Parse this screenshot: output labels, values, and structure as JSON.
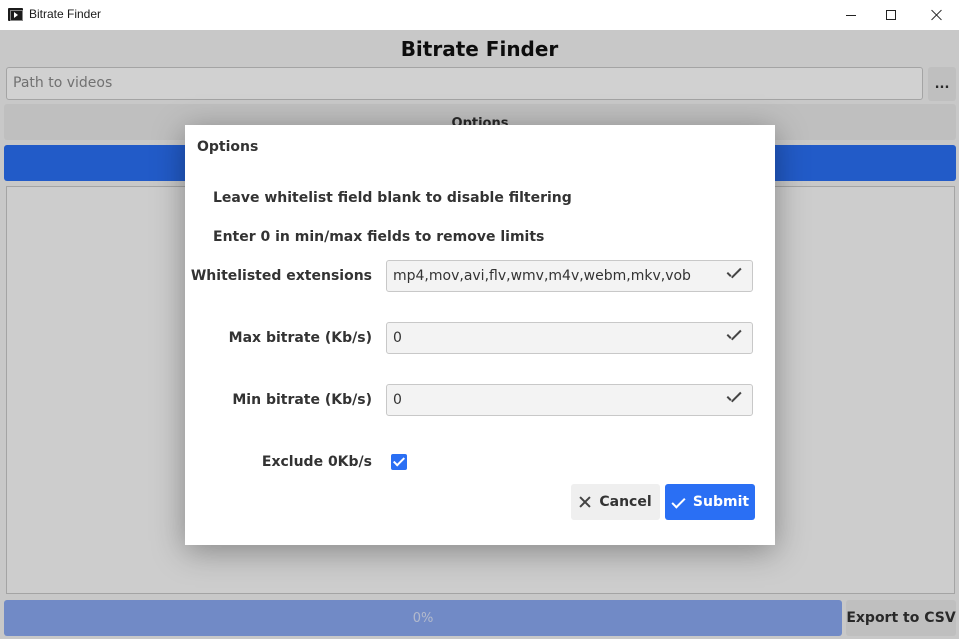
{
  "window": {
    "title": "Bitrate Finder",
    "icon": "film-icon"
  },
  "main": {
    "heading": "Bitrate Finder",
    "path_placeholder": "Path to videos",
    "browse_label": "...",
    "options_label": "Options",
    "progress_text": "0%",
    "progress_value": 0,
    "export_label": "Export to CSV"
  },
  "dialog": {
    "title": "Options",
    "note_whitelist": "Leave whitelist field blank to disable filtering",
    "note_limits": "Enter 0 in min/max fields to remove limits",
    "whitelist_label": "Whitelisted extensions",
    "whitelist_value": "mp4,mov,avi,flv,wmv,m4v,webm,mkv,vob",
    "max_label": "Max bitrate (Kb/s)",
    "max_value": "0",
    "min_label": "Min bitrate (Kb/s)",
    "min_value": "0",
    "exclude_label": "Exclude 0Kb/s",
    "exclude_checked": true,
    "cancel_label": "Cancel",
    "submit_label": "Submit"
  },
  "colors": {
    "accent": "#2a6ff4",
    "progress_fill": "#8aa9f2"
  }
}
